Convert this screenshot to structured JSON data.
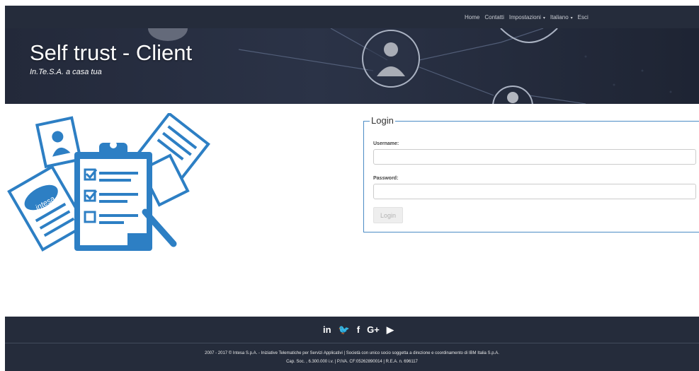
{
  "nav": {
    "items": [
      {
        "label": "Home"
      },
      {
        "label": "Contatti"
      },
      {
        "label": "Impostazioni",
        "caret": "▾"
      },
      {
        "label": "Italiano",
        "caret": "▾"
      },
      {
        "label": "Esci"
      }
    ]
  },
  "hero": {
    "title": "Self trust - Client",
    "subtitle": "In.Te.S.A. a casa tua"
  },
  "illustration": {
    "logo_text": "intesa",
    "accent_color": "#2d7fc4"
  },
  "login": {
    "legend": "Login",
    "username_label": "Username:",
    "username_value": "",
    "password_label": "Password:",
    "password_value": "",
    "button_label": "Login"
  },
  "social": {
    "icons": [
      {
        "name": "linkedin-icon",
        "glyph": "in"
      },
      {
        "name": "twitter-icon",
        "glyph": "🐦"
      },
      {
        "name": "facebook-icon",
        "glyph": "f"
      },
      {
        "name": "googleplus-icon",
        "glyph": "G+"
      },
      {
        "name": "youtube-icon",
        "glyph": "▶"
      }
    ]
  },
  "footer": {
    "line1": "2007 - 2017 © Intesa S.p.A. - Iniziative Telematiche per Servizi Applicativi | Società con unico socio soggetta a direzione e coordinamento di IBM Italia S.p.A.",
    "line2": "Cap. Soc. , 6.300.000 i.v. | P.IVA. CF:05262890014 | R.E.A. n. 696117"
  },
  "colors": {
    "nav_bg": "#252c3b",
    "login_border": "#4b8bc5",
    "illustration_blue": "#2d7fc4"
  }
}
